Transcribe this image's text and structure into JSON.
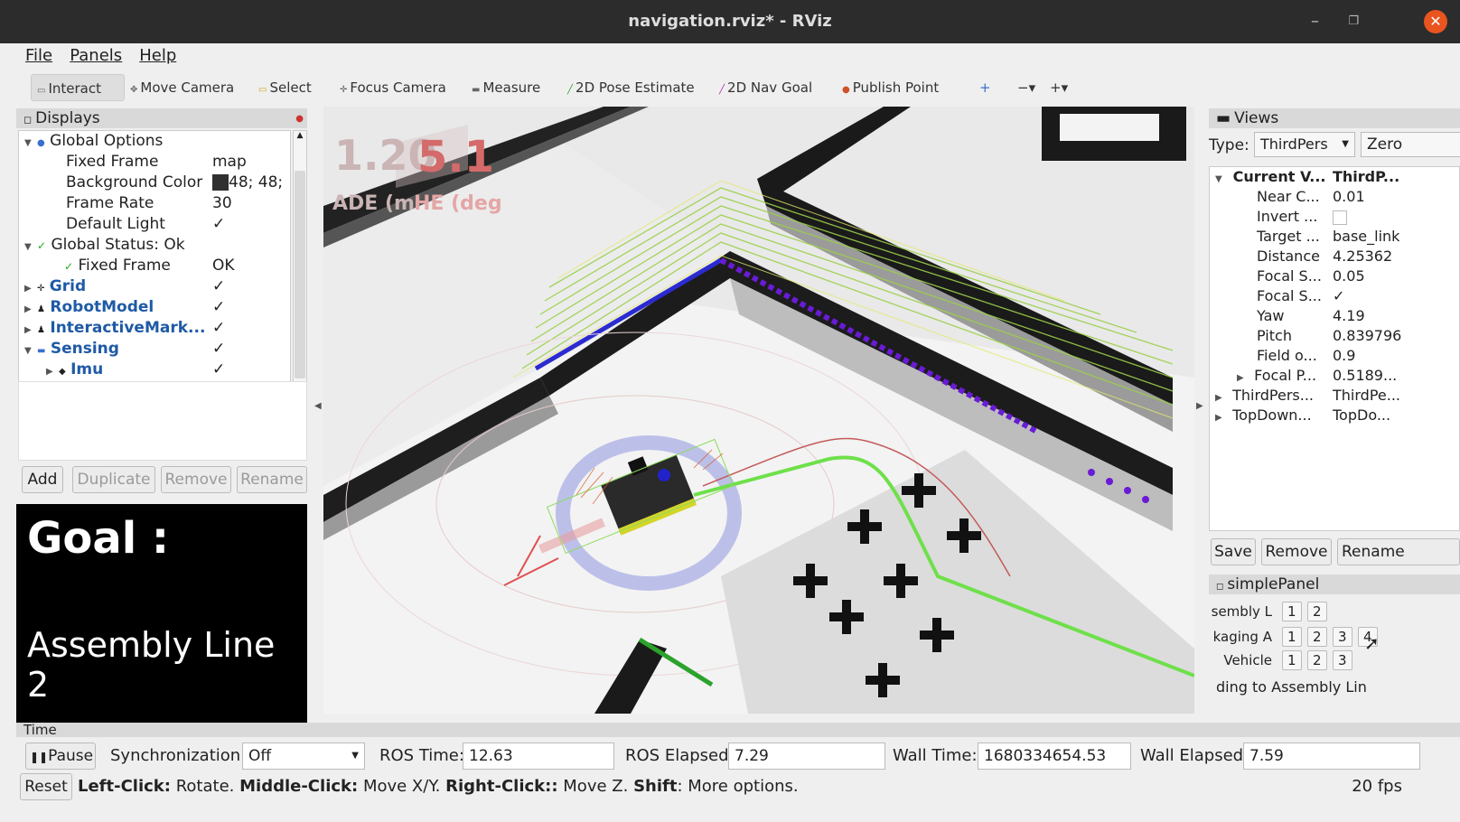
{
  "window": {
    "title": "navigation.rviz* - RViz"
  },
  "menu": {
    "file": "File",
    "panels": "Panels",
    "help": "Help"
  },
  "toolbar": {
    "interact": "Interact",
    "move_camera": "Move Camera",
    "select": "Select",
    "focus_camera": "Focus Camera",
    "measure": "Measure",
    "pose_estimate": "2D Pose Estimate",
    "nav_goal": "2D Nav Goal",
    "publish_point": "Publish Point"
  },
  "displays": {
    "title": "Displays",
    "rows": [
      {
        "label": "Global Options",
        "value": ""
      },
      {
        "label": "Fixed Frame",
        "value": "map"
      },
      {
        "label": "Background Color",
        "value": "48; 48;"
      },
      {
        "label": "Frame Rate",
        "value": "30"
      },
      {
        "label": "Default Light",
        "value": "✓"
      },
      {
        "label": "Global Status: Ok",
        "value": ""
      },
      {
        "label": "Fixed Frame",
        "value": "OK"
      },
      {
        "label": "Grid",
        "value": "✓"
      },
      {
        "label": "RobotModel",
        "value": "✓"
      },
      {
        "label": "InteractiveMark...",
        "value": "✓"
      },
      {
        "label": "Sensing",
        "value": "✓"
      },
      {
        "label": "Imu",
        "value": "✓"
      }
    ],
    "buttons": {
      "add": "Add",
      "duplicate": "Duplicate",
      "remove": "Remove",
      "rename": "Rename"
    }
  },
  "goal": {
    "heading": "Goal :",
    "target": "Assembly Line 2"
  },
  "viewport": {
    "overlay_left": "1.20",
    "overlay_right": "5.1",
    "overlay_left_label": "ADE (m",
    "overlay_right_label": "HE (deg"
  },
  "views": {
    "title": "Views",
    "type_label": "Type:",
    "type_value": "ThirdPers",
    "zero_btn": "Zero",
    "rows": [
      {
        "label": "Current V...",
        "value": "ThirdP..."
      },
      {
        "label": "Near C...",
        "value": "0.01"
      },
      {
        "label": "Invert ...",
        "value": ""
      },
      {
        "label": "Target ...",
        "value": "base_link"
      },
      {
        "label": "Distance",
        "value": "4.25362"
      },
      {
        "label": "Focal S...",
        "value": "0.05"
      },
      {
        "label": "Focal S...",
        "value": "✓"
      },
      {
        "label": "Yaw",
        "value": "4.19"
      },
      {
        "label": "Pitch",
        "value": "0.839796"
      },
      {
        "label": "Field o...",
        "value": "0.9"
      },
      {
        "label": "Focal P...",
        "value": "0.5189..."
      },
      {
        "label": "ThirdPers...",
        "value": "ThirdPe..."
      },
      {
        "label": "TopDown...",
        "value": "TopDo..."
      }
    ],
    "buttons": {
      "save": "Save",
      "remove": "Remove",
      "rename": "Rename"
    }
  },
  "simple_panel": {
    "title": "simplePanel",
    "row1_label": "sembly L",
    "row1_buttons": [
      "1",
      "2"
    ],
    "row2_label": "kaging A",
    "row2_buttons": [
      "1",
      "2",
      "3",
      "4"
    ],
    "row3_label": "Vehicle",
    "row3_buttons": [
      "1",
      "2",
      "3"
    ],
    "status": "ding to Assembly Lin"
  },
  "time": {
    "title": "Time",
    "pause": "Pause",
    "sync_label": "Synchronization:",
    "sync_value": "Off",
    "ros_time_label": "ROS Time:",
    "ros_time": "12.63",
    "ros_elapsed_label": "ROS Elapsed:",
    "ros_elapsed": "7.29",
    "wall_time_label": "Wall Time:",
    "wall_time": "1680334654.53",
    "wall_elapsed_label": "Wall Elapsed:",
    "wall_elapsed": "7.59"
  },
  "status": {
    "reset": "Reset",
    "left_key": "Left-Click:",
    "left_desc": "Rotate.",
    "middle_key": "Middle-Click:",
    "middle_desc": "Move X/Y.",
    "right_key": "Right-Click::",
    "right_desc": "Move Z.",
    "shift_key": "Shift",
    "shift_desc": ": More options.",
    "fps": "20 fps"
  },
  "colors": {
    "accent_close": "#e9541f",
    "blue_label": "#1f5aa6",
    "scan_green": "#7ddc2c",
    "path_purple": "#6a1bd6"
  }
}
